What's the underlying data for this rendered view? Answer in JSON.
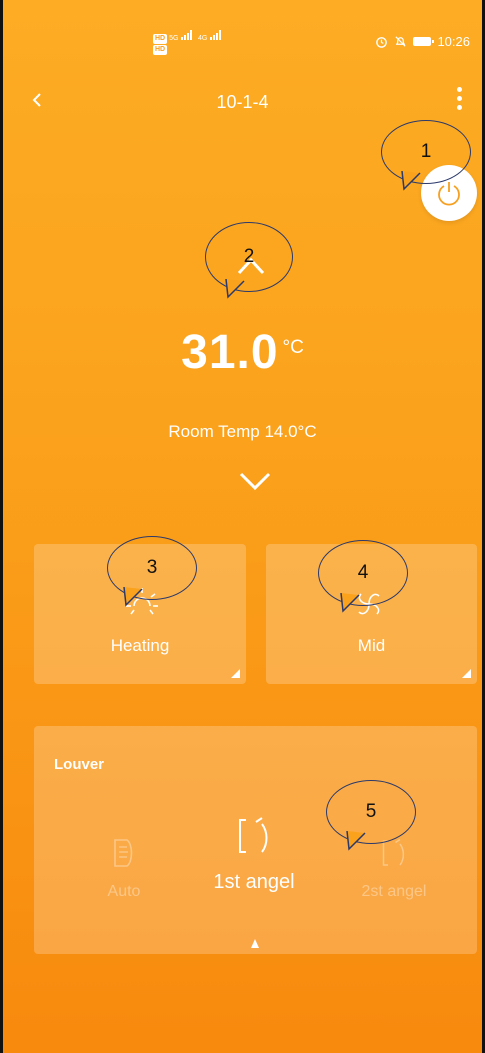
{
  "status_bar": {
    "left_badges": [
      "HD",
      "HD"
    ],
    "network_5g": "5G",
    "network_4g": "4G",
    "time": "10:26"
  },
  "header": {
    "title": "10-1-4"
  },
  "thermostat": {
    "set_temp": "31.0",
    "unit": "°C",
    "room_temp": "Room Temp 14.0°C"
  },
  "mode_card": {
    "label": "Heating",
    "icon": "sun-icon"
  },
  "fan_card": {
    "label": "Mid",
    "icon": "fan-icon"
  },
  "louver": {
    "title": "Louver",
    "options": [
      {
        "label": "Auto",
        "icon": "louver-auto-icon",
        "selected": false
      },
      {
        "label": "1st angel",
        "icon": "louver-angle-icon",
        "selected": true
      },
      {
        "label": "2st angel",
        "icon": "louver-angle-icon",
        "selected": false
      }
    ]
  },
  "annotations": [
    "1",
    "2",
    "3",
    "4",
    "5"
  ],
  "colors": {
    "accent": "#fba21c",
    "annotation_border": "#2c3a6b"
  }
}
